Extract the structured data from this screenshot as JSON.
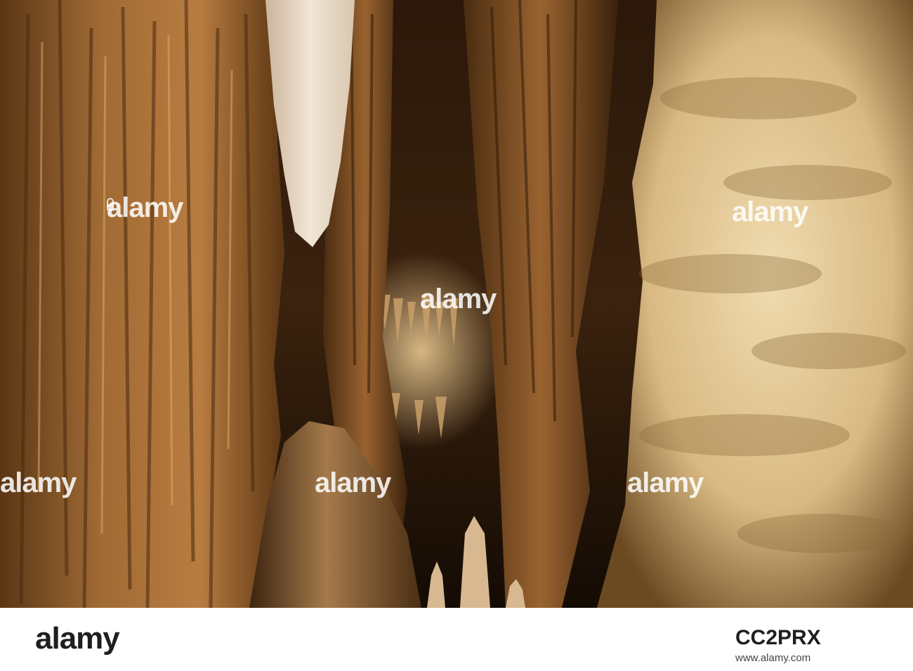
{
  "photo": {
    "subject": "cave-stalactites",
    "palette": {
      "shadow": "#1a0f06",
      "deep": "#3d2410",
      "mid": "#8a5a2b",
      "warm": "#c58a4a",
      "light": "#e7c89a",
      "highlight": "#f3e3c4"
    }
  },
  "watermark": {
    "text": "alamy",
    "icon": "lock-icon"
  },
  "footer": {
    "logo_text": "alamy",
    "image_id": "CC2PRX",
    "url": "www.alamy.com",
    "background": "#ffffff",
    "text_color": "#1f1f1f"
  }
}
